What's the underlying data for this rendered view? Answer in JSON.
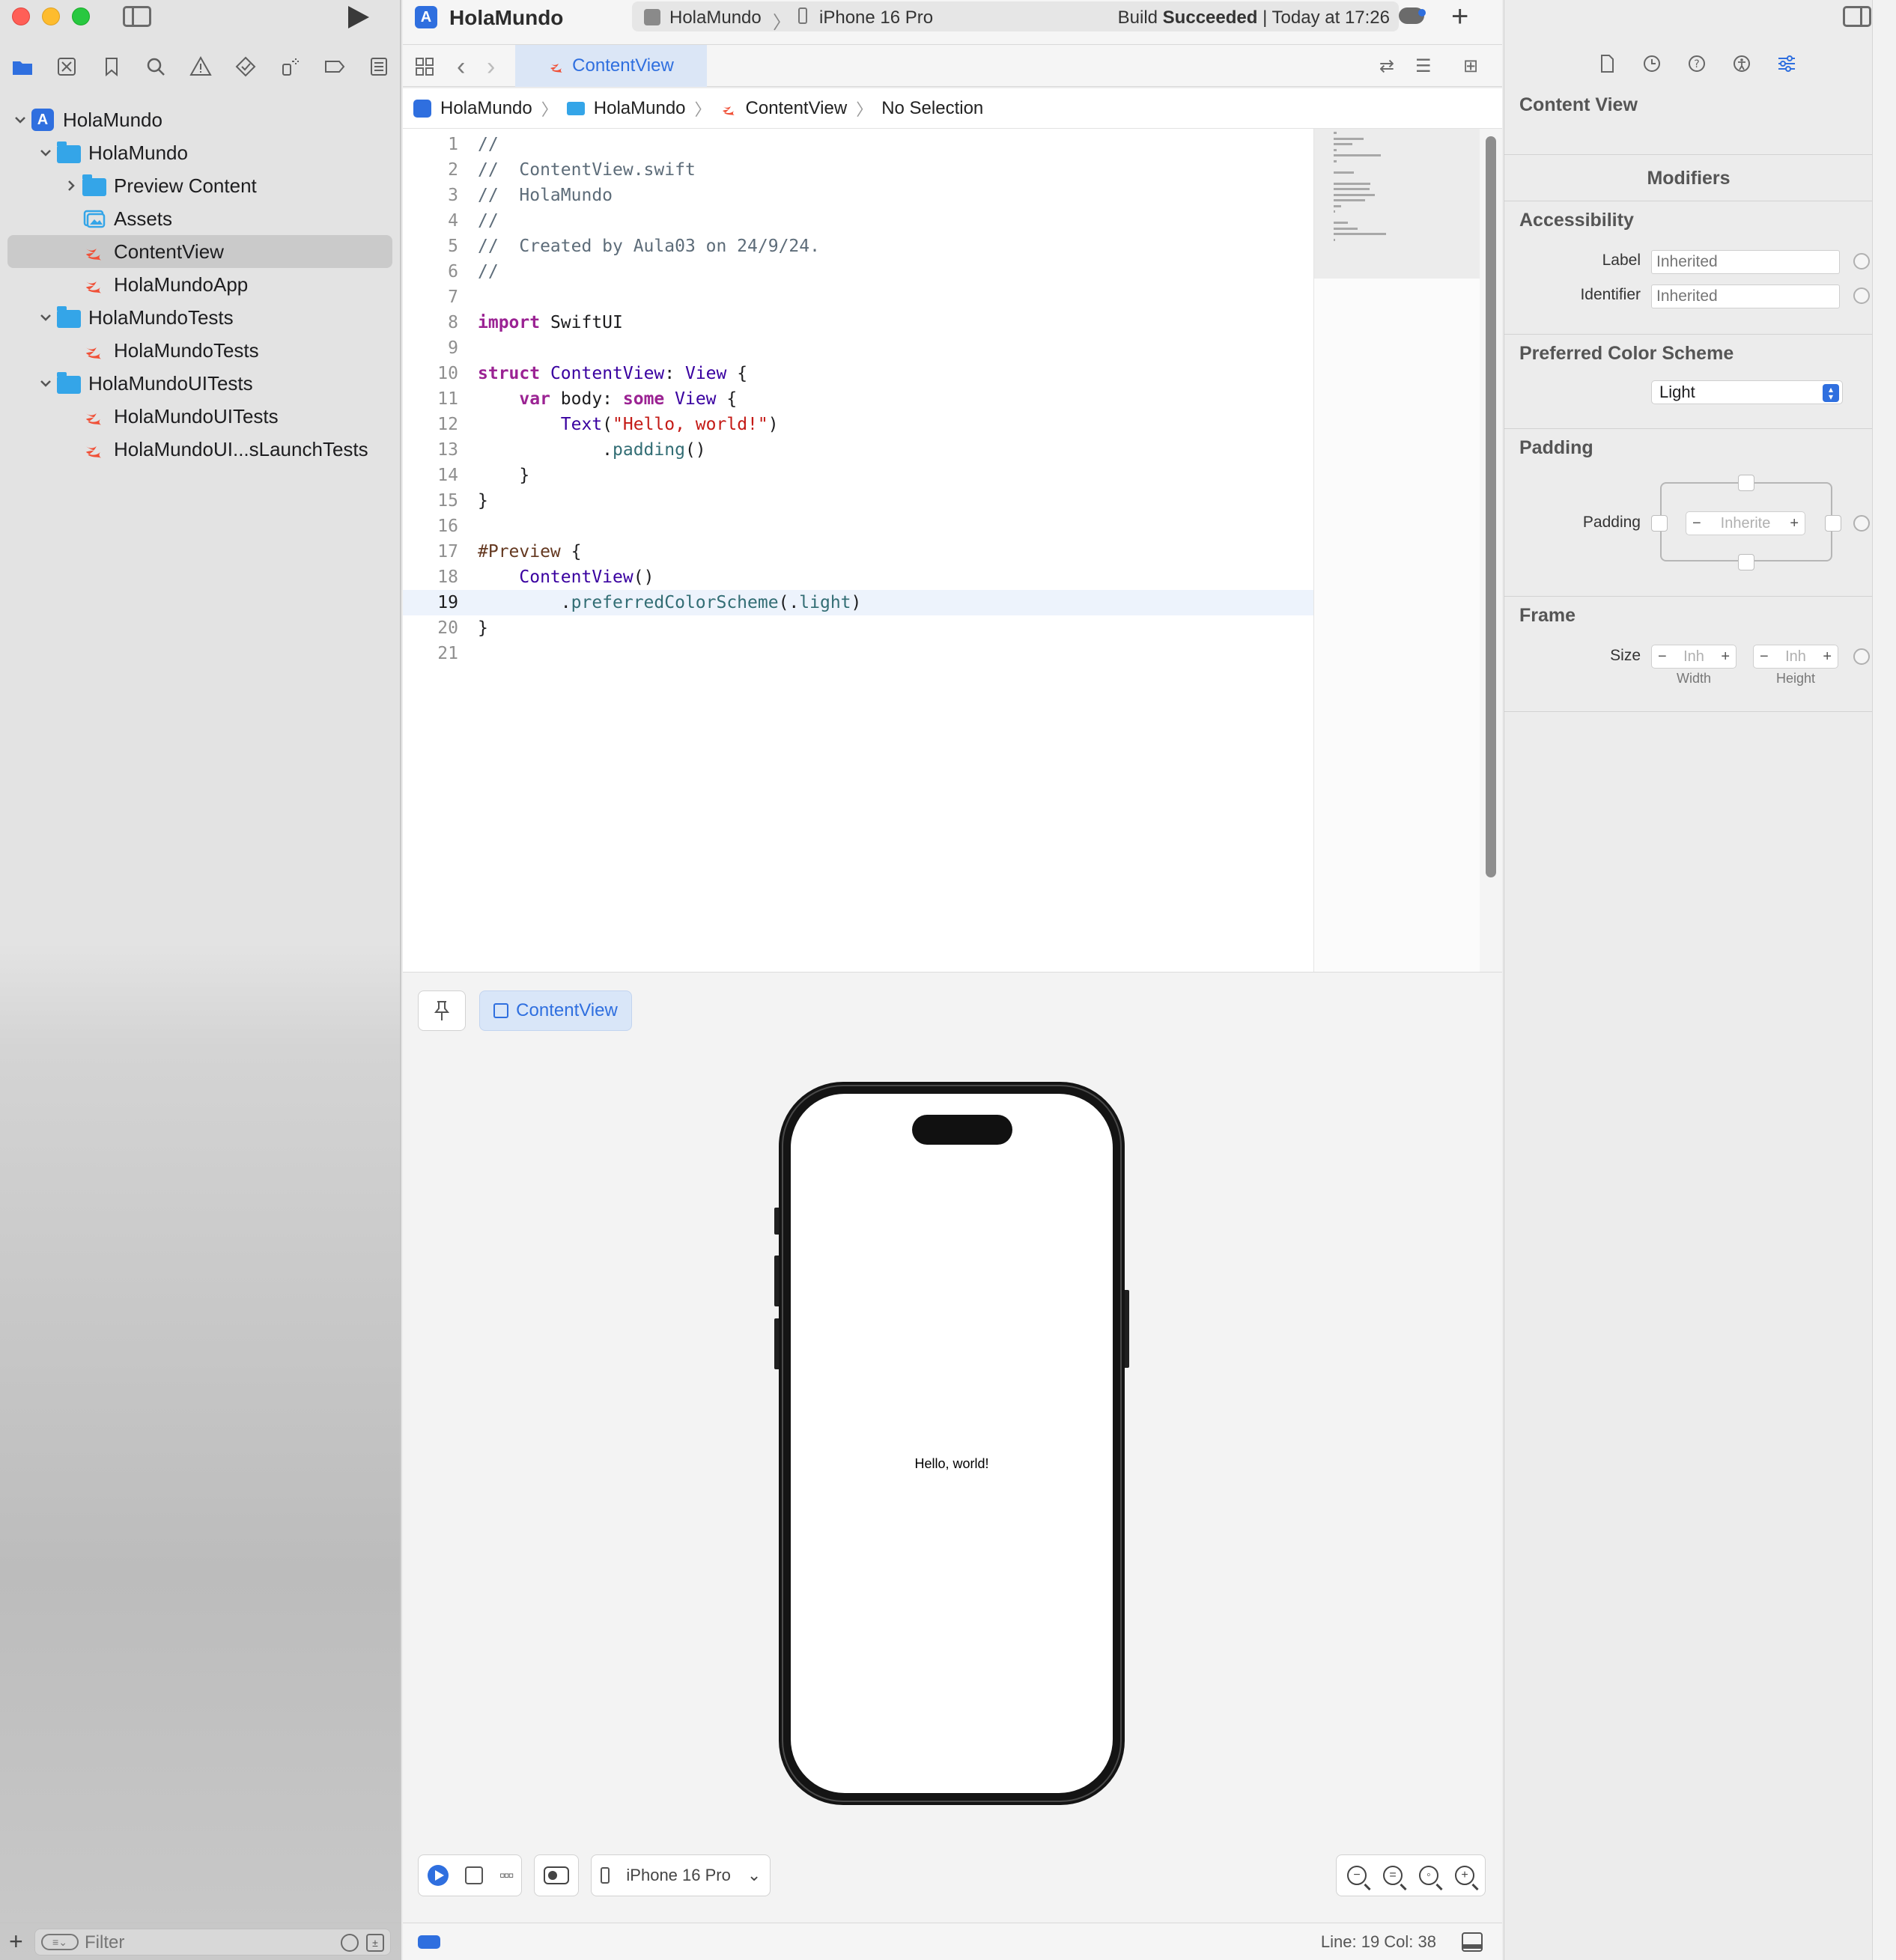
{
  "window": {
    "app_title": "HolaMundo",
    "scheme": "HolaMundo",
    "destination": "iPhone 16 Pro",
    "build_status_prefix": "Build",
    "build_status_bold": "Succeeded",
    "build_status_suffix": "| Today at 17:26"
  },
  "navigator": {
    "tree": [
      {
        "label": "HolaMundo",
        "kind": "project",
        "level": 0,
        "expanded": true
      },
      {
        "label": "HolaMundo",
        "kind": "folder",
        "level": 1,
        "expanded": true
      },
      {
        "label": "Preview Content",
        "kind": "folder",
        "level": 2,
        "expanded": false
      },
      {
        "label": "Assets",
        "kind": "assets",
        "level": 2
      },
      {
        "label": "ContentView",
        "kind": "swift",
        "level": 2,
        "selected": true
      },
      {
        "label": "HolaMundoApp",
        "kind": "swift",
        "level": 2
      },
      {
        "label": "HolaMundoTests",
        "kind": "folder",
        "level": 1,
        "expanded": true
      },
      {
        "label": "HolaMundoTests",
        "kind": "swift",
        "level": 2
      },
      {
        "label": "HolaMundoUITests",
        "kind": "folder",
        "level": 1,
        "expanded": true
      },
      {
        "label": "HolaMundoUITests",
        "kind": "swift",
        "level": 2
      },
      {
        "label": "HolaMundoUI...sLaunchTests",
        "kind": "swift",
        "level": 2
      }
    ],
    "filter_placeholder": "Filter"
  },
  "editor": {
    "tab_label": "ContentView",
    "jumpbar": [
      "HolaMundo",
      "HolaMundo",
      "ContentView",
      "No Selection"
    ],
    "current_line": 19,
    "lines": [
      [
        [
          "c-comment",
          "//"
        ]
      ],
      [
        [
          "c-comment",
          "//  ContentView.swift"
        ]
      ],
      [
        [
          "c-comment",
          "//  HolaMundo"
        ]
      ],
      [
        [
          "c-comment",
          "//"
        ]
      ],
      [
        [
          "c-comment",
          "//  Created by Aula03 on 24/9/24."
        ]
      ],
      [
        [
          "c-comment",
          "//"
        ]
      ],
      [],
      [
        [
          "c-kw",
          "import"
        ],
        [
          "c-plain",
          " SwiftUI"
        ]
      ],
      [],
      [
        [
          "c-kw",
          "struct"
        ],
        [
          "c-plain",
          " "
        ],
        [
          "c-type",
          "ContentView"
        ],
        [
          "c-plain",
          ": "
        ],
        [
          "c-type",
          "View"
        ],
        [
          "c-plain",
          " {"
        ]
      ],
      [
        [
          "c-plain",
          "    "
        ],
        [
          "c-kw",
          "var"
        ],
        [
          "c-plain",
          " body: "
        ],
        [
          "c-kw",
          "some"
        ],
        [
          "c-plain",
          " "
        ],
        [
          "c-type",
          "View"
        ],
        [
          "c-plain",
          " {"
        ]
      ],
      [
        [
          "c-plain",
          "        "
        ],
        [
          "c-type",
          "Text"
        ],
        [
          "c-plain",
          "("
        ],
        [
          "c-str",
          "\"Hello, world!\""
        ],
        [
          "c-plain",
          ")"
        ]
      ],
      [
        [
          "c-plain",
          "            ."
        ],
        [
          "c-fn",
          "padding"
        ],
        [
          "c-plain",
          "()"
        ]
      ],
      [
        [
          "c-plain",
          "    }"
        ]
      ],
      [
        [
          "c-plain",
          "}"
        ]
      ],
      [],
      [
        [
          "c-macro",
          "#Preview"
        ],
        [
          "c-plain",
          " {"
        ]
      ],
      [
        [
          "c-plain",
          "    "
        ],
        [
          "c-type",
          "ContentView"
        ],
        [
          "c-plain",
          "()"
        ]
      ],
      [
        [
          "c-plain",
          "        ."
        ],
        [
          "c-fn",
          "preferredColorScheme"
        ],
        [
          "c-plain",
          "(."
        ],
        [
          "c-fn",
          "light"
        ],
        [
          "c-plain",
          ")"
        ]
      ],
      [
        [
          "c-plain",
          "}"
        ]
      ],
      []
    ]
  },
  "canvas": {
    "preview_chip": "ContentView",
    "phone_text": "Hello, world!",
    "device_menu": "iPhone 16 Pro"
  },
  "statusbar": {
    "position": "Line: 19  Col: 38"
  },
  "inspector": {
    "title": "Content View",
    "modifiers_header": "Modifiers",
    "accessibility_header": "Accessibility",
    "label_label": "Label",
    "label_placeholder": "Inherited",
    "identifier_label": "Identifier",
    "identifier_placeholder": "Inherited",
    "color_scheme_header": "Preferred Color Scheme",
    "color_scheme_value": "Light",
    "padding_header": "Padding",
    "padding_label": "Padding",
    "padding_value": "Inherite",
    "frame_header": "Frame",
    "size_label": "Size",
    "width_value": "Inh",
    "height_value": "Inh",
    "width_caption": "Width",
    "height_caption": "Height"
  },
  "colors": {
    "accent": "#2f6fdf",
    "folder": "#34a5e8",
    "swift": "#f05138",
    "traffic_close": "#ff5f57",
    "traffic_min": "#febc2e",
    "traffic_max": "#28c840"
  }
}
